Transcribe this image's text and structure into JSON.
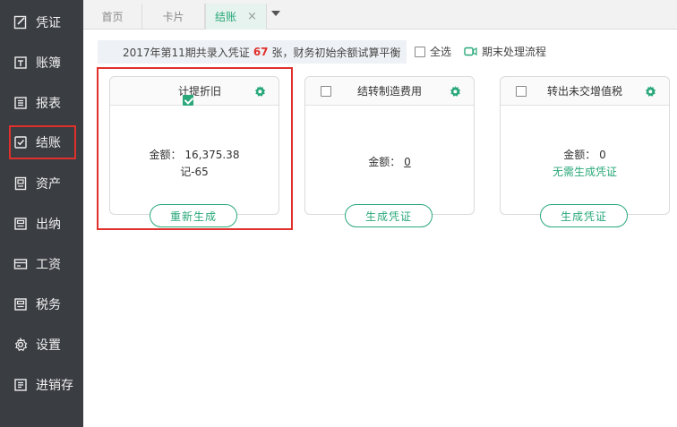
{
  "sidebar": {
    "items": [
      {
        "label": "凭证",
        "icon": "voucher-icon"
      },
      {
        "label": "账簿",
        "icon": "ledger-icon"
      },
      {
        "label": "报表",
        "icon": "report-icon"
      },
      {
        "label": "结账",
        "icon": "checkout-icon",
        "highlighted": true
      },
      {
        "label": "资产",
        "icon": "asset-icon"
      },
      {
        "label": "出纳",
        "icon": "cashier-icon"
      },
      {
        "label": "工资",
        "icon": "salary-icon"
      },
      {
        "label": "税务",
        "icon": "tax-icon"
      },
      {
        "label": "设置",
        "icon": "gear-icon"
      },
      {
        "label": "进销存",
        "icon": "inventory-icon"
      }
    ]
  },
  "tabs": {
    "items": [
      {
        "label": "首页"
      },
      {
        "label": "卡片"
      },
      {
        "label": "结账",
        "active": true,
        "close": "×"
      }
    ]
  },
  "summary": {
    "prefix": "2017年第11期共录入凭证",
    "count": "67",
    "suffix": "张，财务初始余额试算平衡"
  },
  "select_all": {
    "label": "全选"
  },
  "process": {
    "label": "期末处理流程"
  },
  "cards": [
    {
      "title": "计提折旧",
      "checked": true,
      "amount_label": "金额：",
      "amount": "16,375.38",
      "sub": "记-65",
      "button": "重新生成"
    },
    {
      "title": "结转制造费用",
      "checked": false,
      "amount_label": "金额：",
      "amount": "0",
      "button": "生成凭证"
    },
    {
      "title": "转出未交增值税",
      "checked": false,
      "amount_label": "金额：",
      "amount": "0",
      "note": "无需生成凭证",
      "button": "生成凭证"
    }
  ],
  "colors": {
    "accent": "#2aa87a",
    "highlight": "#e0302c",
    "sidebar_bg": "#3a3d42"
  }
}
